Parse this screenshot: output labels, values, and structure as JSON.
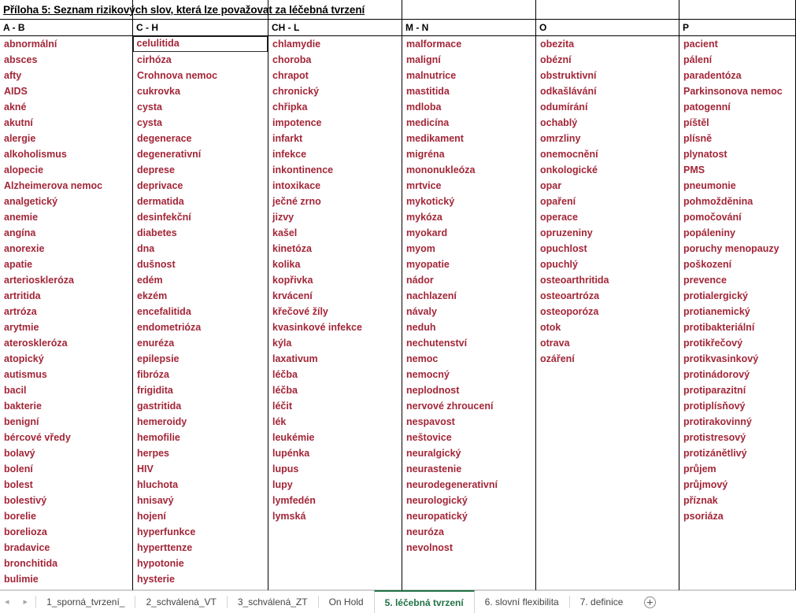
{
  "document": {
    "title": "Příloha 5: Seznam rizikových slov, která lze považovat za léčebná tvrzení"
  },
  "table": {
    "headers": [
      "A - B",
      "C - H",
      "CH - L",
      "M - N",
      "O",
      "P"
    ],
    "active_cell": "celulitida",
    "columns": [
      {
        "header": "A - B",
        "words": [
          "abnormální",
          "absces",
          "afty",
          "AIDS",
          "akné",
          "akutní",
          "alergie",
          "alkoholismus",
          "alopecie",
          "Alzheimerova nemoc",
          "analgetický",
          "anemie",
          "angína",
          "anorexie",
          "apatie",
          "arterioskleróza",
          "artritida",
          "artróza",
          "arytmie",
          "ateroskleróza",
          "atopický",
          "autismus",
          "bacil",
          "bakterie",
          "benigní",
          "bércové vředy",
          "bolavý",
          "bolení",
          "bolest",
          "bolestivý",
          "borelie",
          "borelioza",
          "bradavice",
          "bronchitida",
          "bulimie"
        ]
      },
      {
        "header": "C - H",
        "words": [
          "celulitida",
          "cirhóza",
          "Crohnova nemoc",
          "cukrovka",
          "cysta",
          "cysta",
          "degenerace",
          "degenerativní",
          "deprese",
          "deprivace",
          "dermatida",
          "desinfekční",
          "diabetes",
          "dna",
          "dušnost",
          "edém",
          "ekzém",
          "encefalitida",
          "endometrióza",
          "enuréza",
          "epilepsie",
          "fibróza",
          "frigidita",
          "gastritida",
          "hemeroidy",
          "hemofilie",
          "herpes",
          "HIV",
          "hluchota",
          "hnisavý",
          "hojení",
          "hyperfunkce",
          "hyperttenze",
          "hypotonie",
          "hysterie"
        ]
      },
      {
        "header": "CH - L",
        "words": [
          "chlamydie",
          "choroba",
          "chrapot",
          "chronický",
          "chřipka",
          "impotence",
          "infarkt",
          "infekce",
          "inkontinence",
          "intoxikace",
          "ječné zrno",
          "jizvy",
          "kašel",
          "kinetóza",
          "kolika",
          "kopřivka",
          "krvácení",
          "křečové žíly",
          "kvasinkové infekce",
          "kýla",
          "laxativum",
          "léčba",
          "léčba",
          "léčit",
          "lék",
          "leukémie",
          "lupénka",
          "lupus",
          "lupy",
          "lymfedén",
          "lymská"
        ]
      },
      {
        "header": "M - N",
        "words": [
          "malformace",
          "maligní",
          "malnutrice",
          "mastitida",
          "mdloba",
          "medicína",
          "medikament",
          "migréna",
          "mononukleóza",
          "mrtvice",
          "mykotický",
          "mykóza",
          "myokard",
          "myom",
          "myopatie",
          "nádor",
          "nachlazení",
          "návaly",
          "neduh",
          "nechutenství",
          "nemoc",
          "nemocný",
          "neplodnost",
          "nervové zhroucení",
          "nespavost",
          "neštovice",
          "neuralgický",
          "neurastenie",
          "neurodegenerativní",
          "neurologický",
          "neuropatický",
          "neuróza",
          "nevolnost"
        ]
      },
      {
        "header": "O",
        "words": [
          "obezita",
          "obézní",
          "obstruktivní",
          "odkašlávání",
          "odumírání",
          "ochablý",
          "omrzliny",
          "onemocnění",
          "onkologické",
          "opar",
          "opaření",
          "operace",
          "opruzeniny",
          "opuchlost",
          "opuchlý",
          "osteoarthritida",
          "osteoartróza",
          "osteoporóza",
          "otok",
          "otrava",
          "ozáření"
        ]
      },
      {
        "header": "P",
        "words": [
          "pacient",
          "pálení",
          "paradentóza",
          "Parkinsonova nemoc",
          "patogenní",
          "píštěl",
          "plísně",
          "plynatost",
          "PMS",
          "pneumonie",
          "pohmožděnina",
          "pomočování",
          "popáleniny",
          "poruchy menopauzy",
          "poškození",
          "prevence",
          "protialergický",
          "protianemický",
          "protibakteriální",
          "protikřečový",
          "protikvasinkový",
          "protinádorový",
          "protiparazitní",
          "protiplísňový",
          "protirakovinný",
          "protistresový",
          "protizánětlivý",
          "průjem",
          "průjmový",
          "příznak",
          "psoriáza"
        ]
      }
    ]
  },
  "sheet_tabs": {
    "prev_arrow": "◂",
    "next_arrow": "▸",
    "tabs": [
      {
        "label": "1_sporná_tvrzení_",
        "active": false
      },
      {
        "label": "2_schválená_VT",
        "active": false
      },
      {
        "label": "3_schválená_ZT",
        "active": false
      },
      {
        "label": "On Hold",
        "active": false
      },
      {
        "label": "5. léčebná tvrzení",
        "active": true
      },
      {
        "label": "6. slovní flexibilita",
        "active": false
      },
      {
        "label": "7. definice",
        "active": false
      }
    ],
    "add_sheet_label": "+"
  },
  "colors": {
    "word_text": "#A32638",
    "grid_line": "#000000",
    "active_tab": "#217346"
  }
}
